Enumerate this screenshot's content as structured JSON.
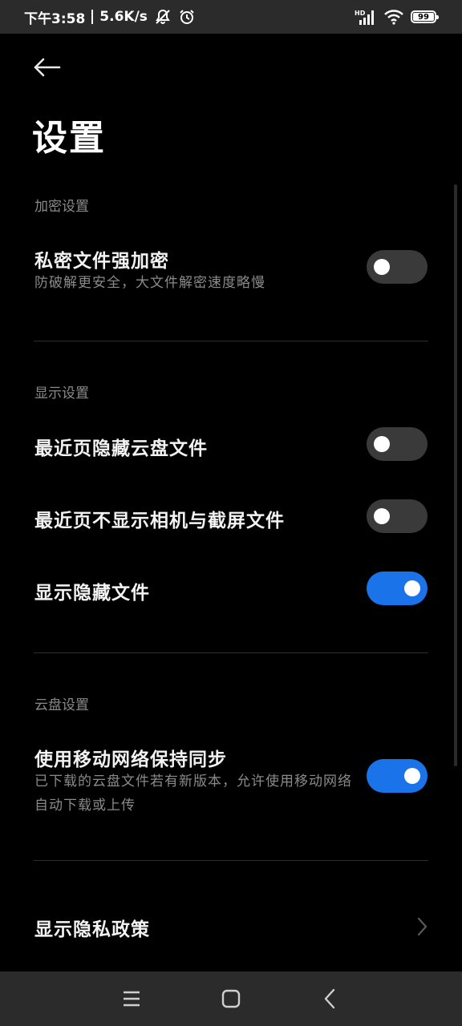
{
  "status_bar": {
    "time": "下午3:58",
    "speed": "5.6K/s",
    "network_badge": "HD",
    "battery": "99",
    "icons": [
      "mute-bell-icon",
      "alarm-icon",
      "signal-icon",
      "wifi-icon",
      "battery-icon"
    ]
  },
  "header": {
    "back_icon": "arrow-left-icon",
    "title": "设置"
  },
  "sections": {
    "encryption": {
      "label": "加密设置",
      "items": [
        {
          "title": "私密文件强加密",
          "subtitle": "防破解更安全，大文件解密速度略慢",
          "enabled": false
        }
      ]
    },
    "display": {
      "label": "显示设置",
      "items": [
        {
          "title": "最近页隐藏云盘文件",
          "enabled": false
        },
        {
          "title": "最近页不显示相机与截屏文件",
          "enabled": false
        },
        {
          "title": "显示隐藏文件",
          "enabled": true
        }
      ]
    },
    "cloud": {
      "label": "云盘设置",
      "items": [
        {
          "title": "使用移动网络保持同步",
          "subtitle": "已下载的云盘文件若有新版本，允许使用移动网络自动下载或上传",
          "enabled": true
        }
      ]
    },
    "privacy": {
      "title": "显示隐私政策"
    }
  },
  "colors": {
    "background": "#000000",
    "toggle_on": "#1a73e8",
    "toggle_off": "#3a3a3a",
    "secondary_text": "#8a8a8a"
  },
  "nav_bar": {
    "icons": [
      "menu-icon",
      "home-icon",
      "back-icon"
    ]
  }
}
